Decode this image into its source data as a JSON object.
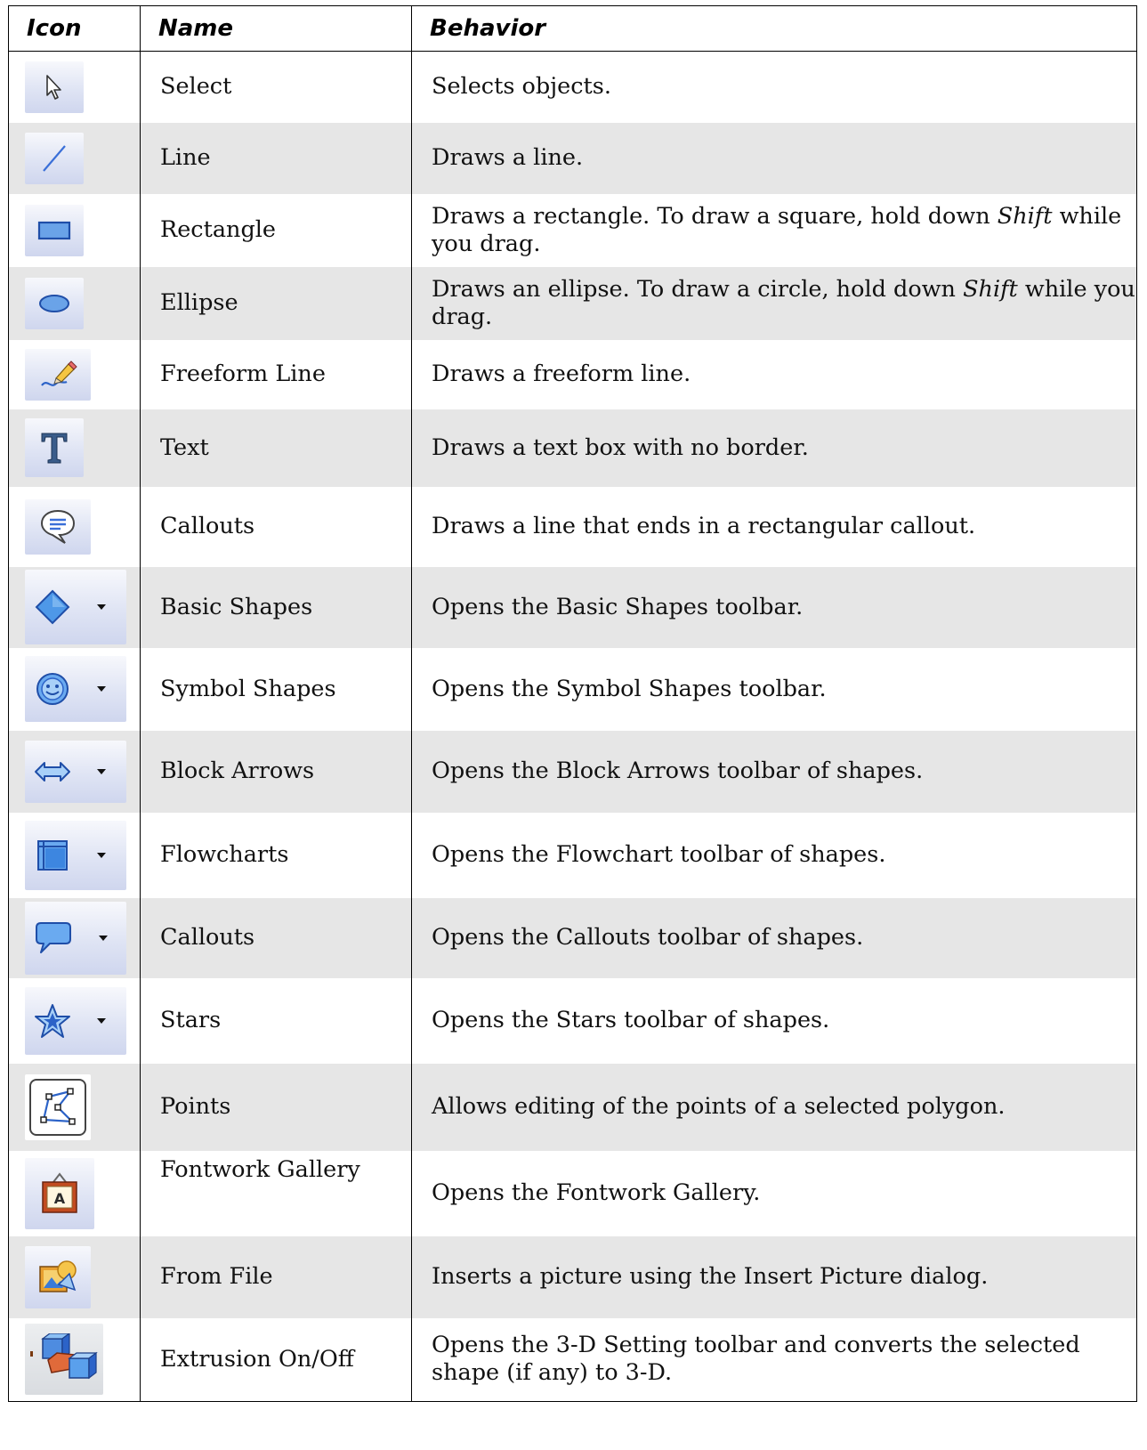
{
  "headers": {
    "icon": "Icon",
    "name": "Name",
    "behavior": "Behavior"
  },
  "rows": [
    {
      "icon": "select-arrow-icon",
      "name": "Select",
      "behavior": "Selects objects."
    },
    {
      "icon": "line-icon",
      "name": "Line",
      "behavior": "Draws a line."
    },
    {
      "icon": "rectangle-icon",
      "name": "Rectangle",
      "behavior_pre": "Draws a rectangle. To draw a square, hold down ",
      "behavior_em": "Shift",
      "behavior_post": " while you drag."
    },
    {
      "icon": "ellipse-icon",
      "name": "Ellipse",
      "behavior_pre": "Draws an ellipse. To draw a circle, hold down ",
      "behavior_em": "Shift",
      "behavior_post": " while you drag."
    },
    {
      "icon": "freeform-pencil-icon",
      "name": "Freeform Line",
      "behavior": "Draws a freeform line."
    },
    {
      "icon": "text-t-icon",
      "name": "Text",
      "behavior": "Draws a text box with no border."
    },
    {
      "icon": "callout-bubble-icon",
      "name": "Callouts",
      "behavior": "Draws a line that ends in a rectangular callout."
    },
    {
      "icon": "diamond-icon",
      "name": "Basic Shapes",
      "behavior": "Opens the Basic Shapes toolbar."
    },
    {
      "icon": "smiley-icon",
      "name": "Symbol Shapes",
      "behavior": "Opens the Symbol Shapes toolbar."
    },
    {
      "icon": "double-arrow-icon",
      "name": "Block Arrows",
      "behavior": "Opens the Block Arrows toolbar of shapes."
    },
    {
      "icon": "flowchart-icon",
      "name": "Flowcharts",
      "behavior": "Opens the Flowchart toolbar of shapes."
    },
    {
      "icon": "speech-bubble-icon",
      "name": "Callouts",
      "behavior": "Opens the Callouts toolbar of shapes."
    },
    {
      "icon": "star-icon",
      "name": "Stars",
      "behavior": "Opens the Stars toolbar of shapes."
    },
    {
      "icon": "points-polygon-icon",
      "name": "Points",
      "behavior": "Allows editing of the points of a selected polygon."
    },
    {
      "icon": "fontwork-gallery-icon",
      "name": "Fontwork Gallery",
      "behavior": "Opens the Fontwork Gallery."
    },
    {
      "icon": "picture-from-file-icon",
      "name": "From File",
      "behavior": "Inserts a picture using the Insert Picture dialog."
    },
    {
      "icon": "extrusion-3d-icon",
      "name": "Extrusion On/Off",
      "behavior": "Opens the 3-D Setting toolbar and converts the selected shape (if any) to 3-D."
    }
  ]
}
